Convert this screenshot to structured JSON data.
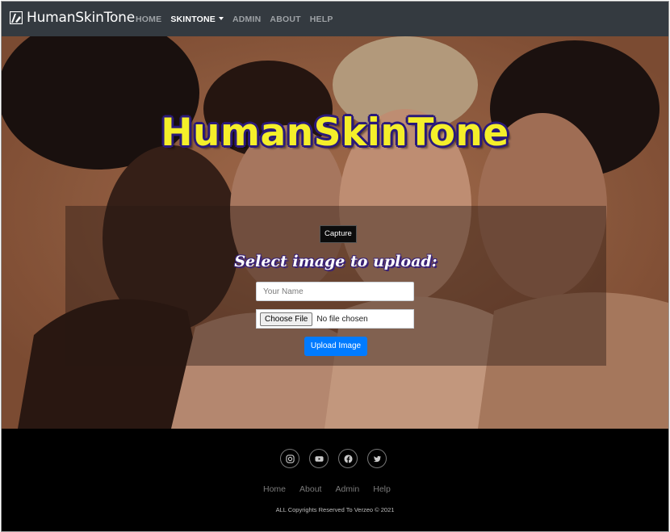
{
  "navbar": {
    "brand": "HumanSkinTone",
    "items": [
      {
        "label": "HOME",
        "active": false
      },
      {
        "label": "SKINTONE",
        "active": true,
        "dropdown": true
      },
      {
        "label": "ADMIN",
        "active": false
      },
      {
        "label": "ABOUT",
        "active": false
      },
      {
        "label": "HELP",
        "active": false
      }
    ]
  },
  "hero": {
    "title": "HumanSkinTone",
    "capture_label": "Capture",
    "upload_heading": "Select image to upload:",
    "name_placeholder": "Your Name",
    "file_button": "Choose File",
    "file_status": "No file chosen",
    "upload_label": "Upload Image"
  },
  "footer": {
    "socials": [
      "instagram-icon",
      "youtube-icon",
      "facebook-icon",
      "twitter-icon"
    ],
    "links": [
      "Home",
      "About",
      "Admin",
      "Help"
    ],
    "copyright": "ALL Copyrights Reserved To Verzeo © 2021"
  },
  "colors": {
    "navbar_bg": "#343a40",
    "title_yellow": "#f4ef2a",
    "title_outline": "#2a1a7a",
    "upload_blue": "#007bff",
    "footer_bg": "#000000"
  }
}
